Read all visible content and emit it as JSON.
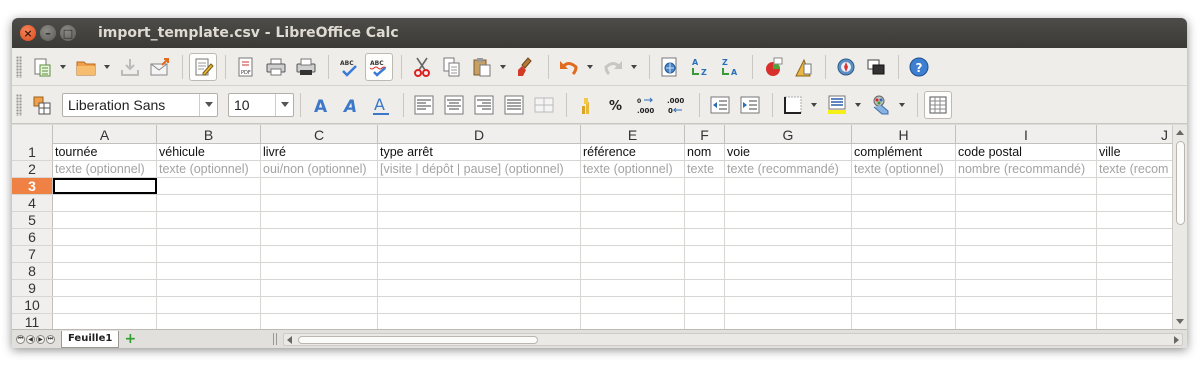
{
  "window": {
    "title": "import_template.csv - LibreOffice Calc",
    "close_glyph": "×",
    "min_glyph": "–",
    "max_glyph": "□"
  },
  "format_toolbar": {
    "font_name": "Liberation Sans",
    "font_size": "10"
  },
  "toolbar_icons": {
    "standard": [
      "new-icon",
      "open-icon",
      "save-icon",
      "send-icon",
      "edit-mode-icon",
      "export-pdf-icon",
      "print-icon",
      "print-preview-icon",
      "spellcheck-icon",
      "autospellcheck-icon",
      "cut-icon",
      "copy-icon",
      "paste-icon",
      "clone-formatting-icon",
      "undo-icon",
      "redo-icon",
      "hyperlink-icon",
      "sort-ascending-icon",
      "sort-descending-icon",
      "chart-icon",
      "navigator-icon",
      "gallery-icon",
      "help-icon"
    ],
    "formatting": [
      "styles-icon",
      "font-color-icon",
      "bold-icon",
      "italic-icon",
      "underline-icon",
      "align-left-icon",
      "align-center-icon",
      "align-right-icon",
      "justify-icon",
      "merge-cells-icon",
      "currency-icon",
      "percent-icon",
      "add-decimal-icon",
      "delete-decimal-icon",
      "decrease-indent-icon",
      "increase-indent-icon",
      "borders-icon",
      "background-color-icon",
      "highlight-icon",
      "gridlines-icon"
    ]
  },
  "sheet": {
    "columns": [
      "A",
      "B",
      "C",
      "D",
      "E",
      "F",
      "G",
      "H",
      "I",
      "J"
    ],
    "row_numbers": [
      "1",
      "2",
      "3",
      "4",
      "5",
      "6",
      "7",
      "8",
      "9",
      "10",
      "11"
    ],
    "active_row": "3",
    "header_row": [
      "tournée",
      "véhicule",
      "livré",
      "type arrêt",
      "référence",
      "nom",
      "voie",
      "complément",
      "code postal",
      "ville"
    ],
    "hint_row": [
      "texte (optionnel)",
      "texte (optionnel)",
      "oui/non (optionnel)",
      "[visite | dépôt | pause] (optionnel)",
      "texte (optionnel)",
      "texte",
      "texte (recommandé)",
      "texte (optionnel)",
      "nombre (recommandé)",
      "texte (recom"
    ]
  },
  "tabs": {
    "sheet_tab": "Feuille1",
    "add_tab_glyph": "+"
  },
  "colors": {
    "active_row_header": "#f08145",
    "hint_text": "#a3a3a3",
    "close_button": "#dc4a1b",
    "titlebar": "#3b3a37"
  }
}
